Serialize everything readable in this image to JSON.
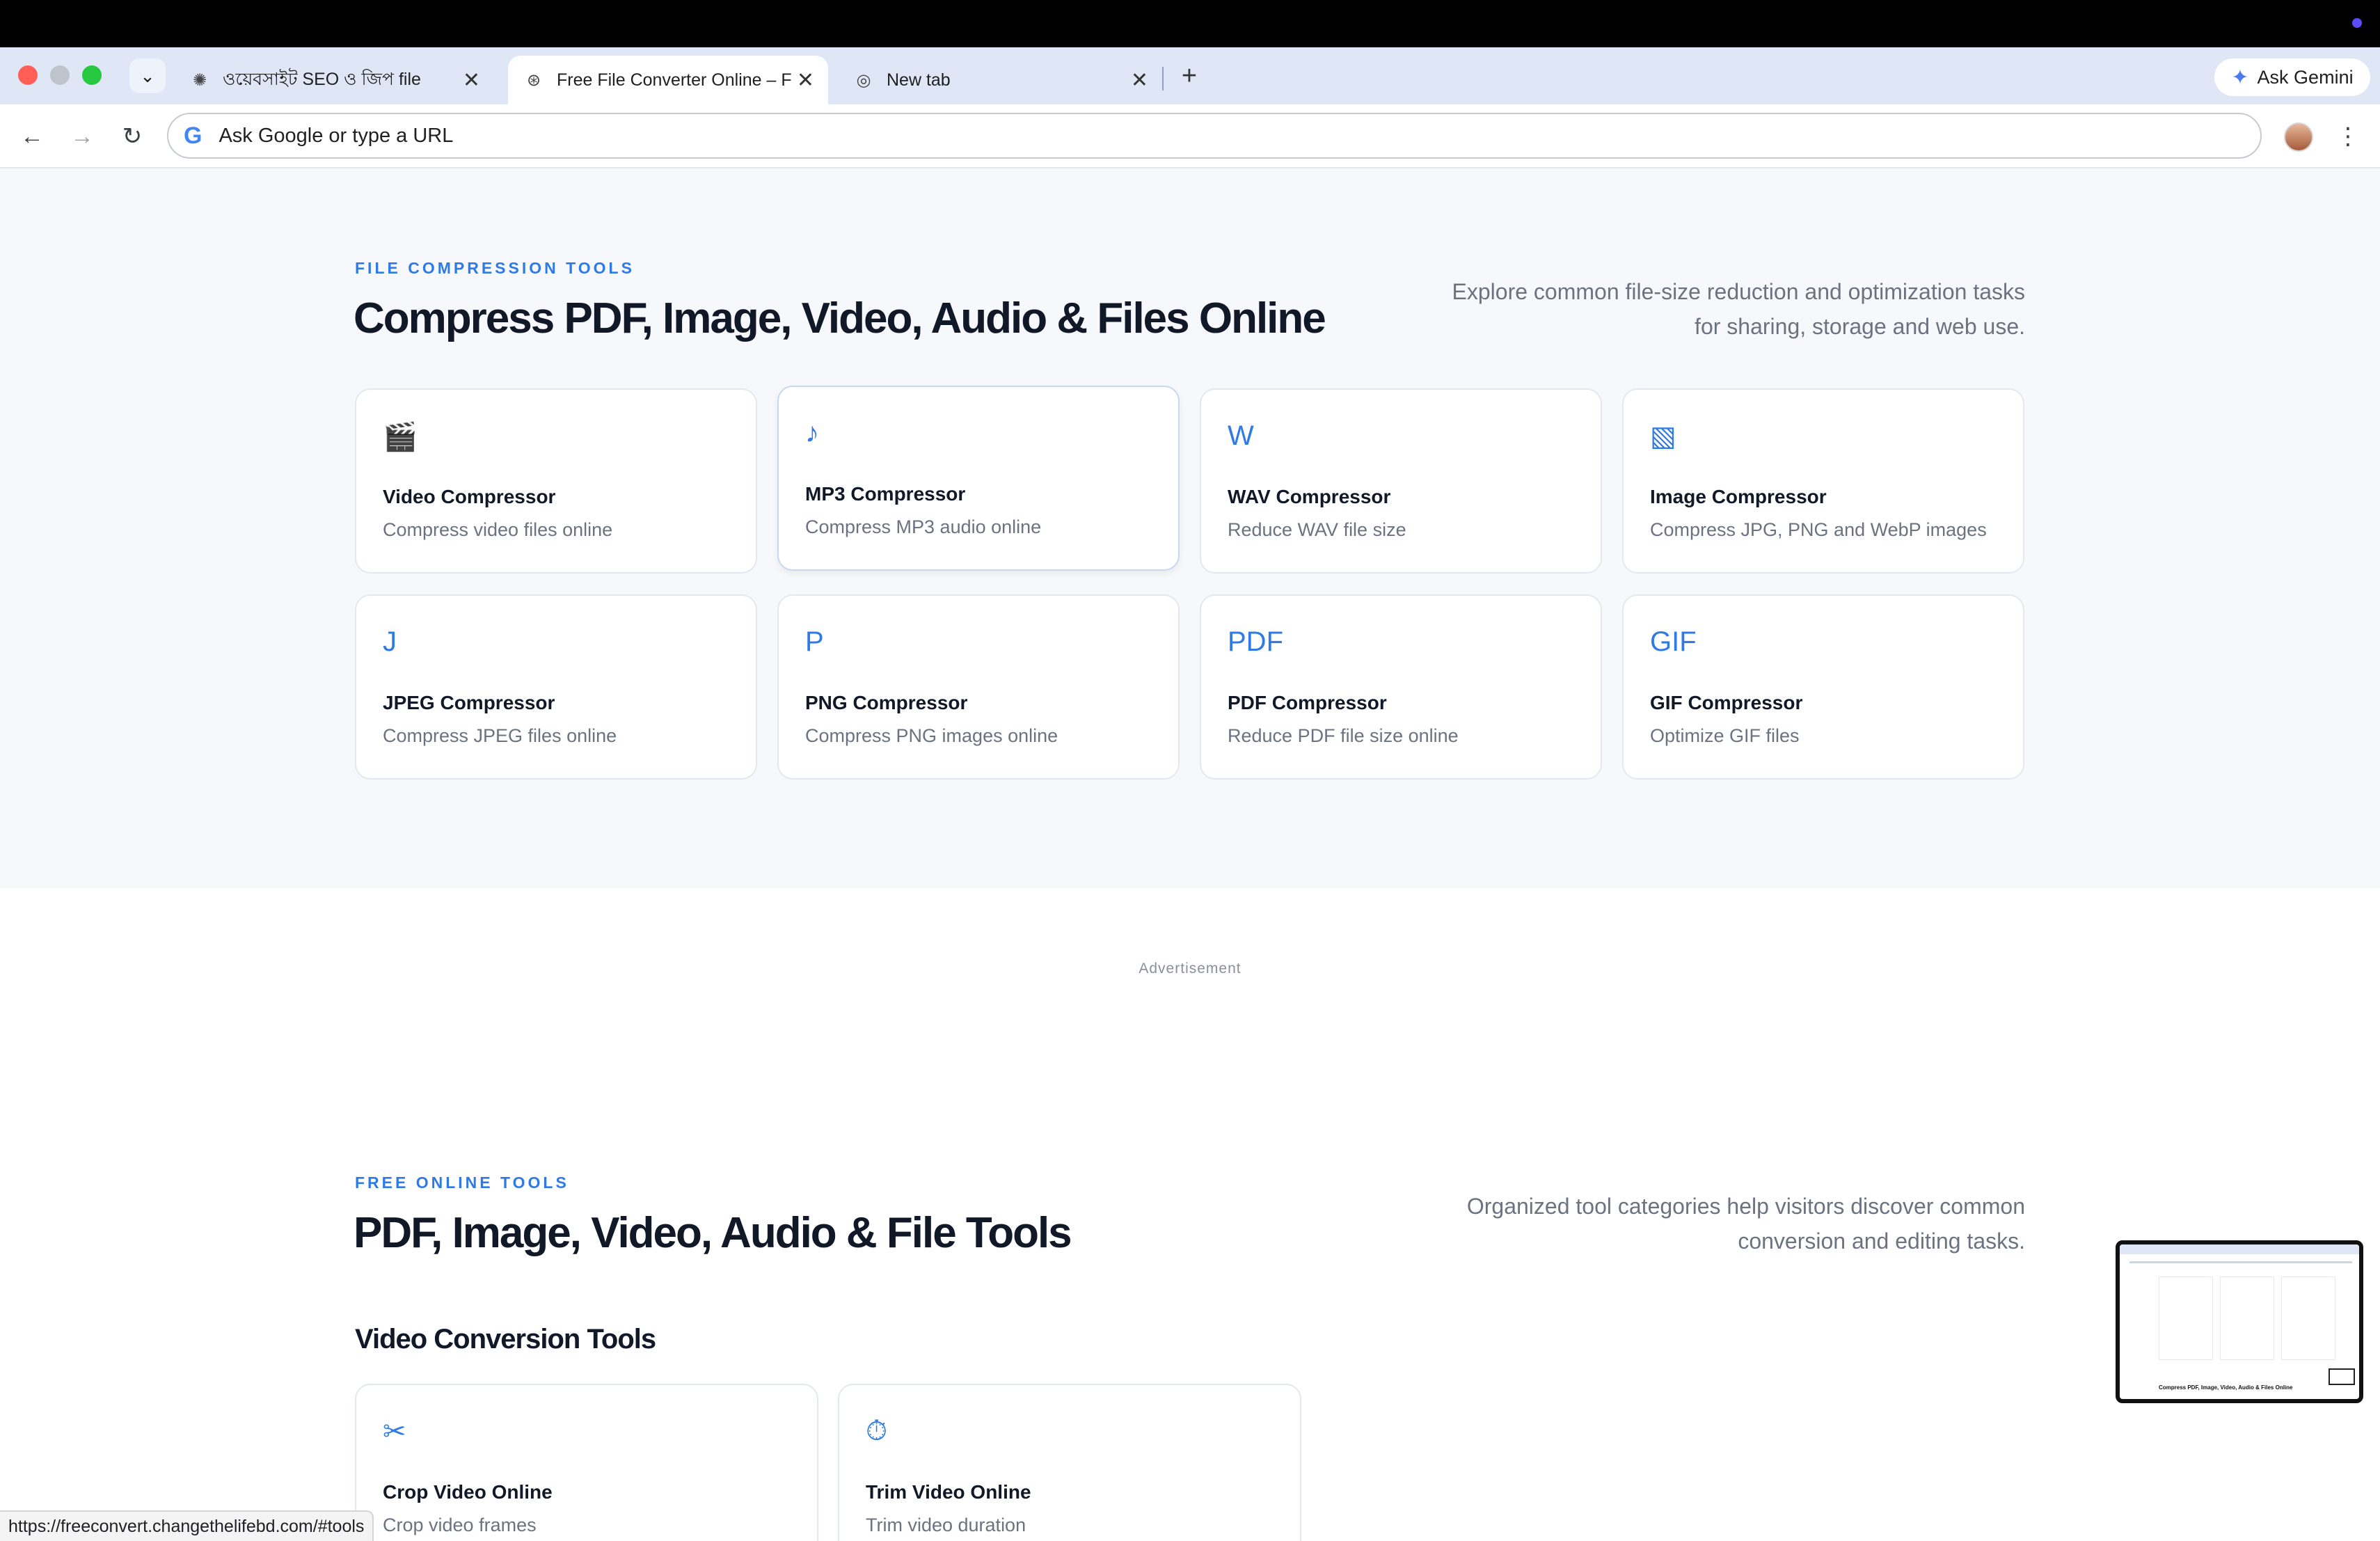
{
  "browser": {
    "tabs": [
      {
        "title": "ওয়েবসাইট SEO ও জিপ file",
        "icon": "chatgpt-icon"
      },
      {
        "title": "Free File Converter Online – F",
        "icon": "site-icon",
        "active": true
      },
      {
        "title": "New tab",
        "icon": "chrome-icon"
      }
    ],
    "ask_gemini": "Ask Gemini",
    "omnibox_placeholder": "Ask Google or type a URL"
  },
  "compression": {
    "eyebrow": "FILE COMPRESSION TOOLS",
    "title": "Compress PDF, Image, Video, Audio & Files Online",
    "description_line1": "Explore common file-size reduction and optimization tasks",
    "description_line2": "for sharing, storage and web use.",
    "cards": [
      {
        "icon": "🎬",
        "icon_name": "clapperboard-icon",
        "name": "Video Compressor",
        "sub": "Compress video files online"
      },
      {
        "icon": "♪",
        "icon_name": "music-note-icon",
        "name": "MP3 Compressor",
        "sub": "Compress MP3 audio online"
      },
      {
        "icon": "W",
        "icon_name": "wav-letter-icon",
        "name": "WAV Compressor",
        "sub": "Reduce WAV file size"
      },
      {
        "icon": "▧",
        "icon_name": "image-pattern-icon",
        "name": "Image Compressor",
        "sub": "Compress JPG, PNG and WebP images"
      },
      {
        "icon": "J",
        "icon_name": "jpeg-letter-icon",
        "name": "JPEG Compressor",
        "sub": "Compress JPEG files online"
      },
      {
        "icon": "P",
        "icon_name": "png-letter-icon",
        "name": "PNG Compressor",
        "sub": "Compress PNG images online"
      },
      {
        "icon": "PDF",
        "icon_name": "pdf-letter-icon",
        "name": "PDF Compressor",
        "sub": "Reduce PDF file size online"
      },
      {
        "icon": "GIF",
        "icon_name": "gif-letter-icon",
        "name": "GIF Compressor",
        "sub": "Optimize GIF files"
      }
    ]
  },
  "advertisement_label": "Advertisement",
  "tools": {
    "eyebrow": "FREE ONLINE TOOLS",
    "title": "PDF, Image, Video, Audio & File Tools",
    "description_line1": "Organized tool categories help visitors discover common",
    "description_line2": "conversion and editing tasks.",
    "video_heading": "Video Conversion Tools",
    "cards": [
      {
        "icon": "✂",
        "icon_name": "scissors-icon",
        "name": "Crop Video Online",
        "sub": "Crop video frames"
      },
      {
        "icon": "⏱",
        "icon_name": "stopwatch-icon",
        "name": "Trim Video Online",
        "sub": "Trim video duration"
      }
    ]
  },
  "preview_caption": "Compress PDF, Image, Video, Audio & Files Online",
  "status_url": "https://freeconvert.changethelifebd.com/#tools"
}
